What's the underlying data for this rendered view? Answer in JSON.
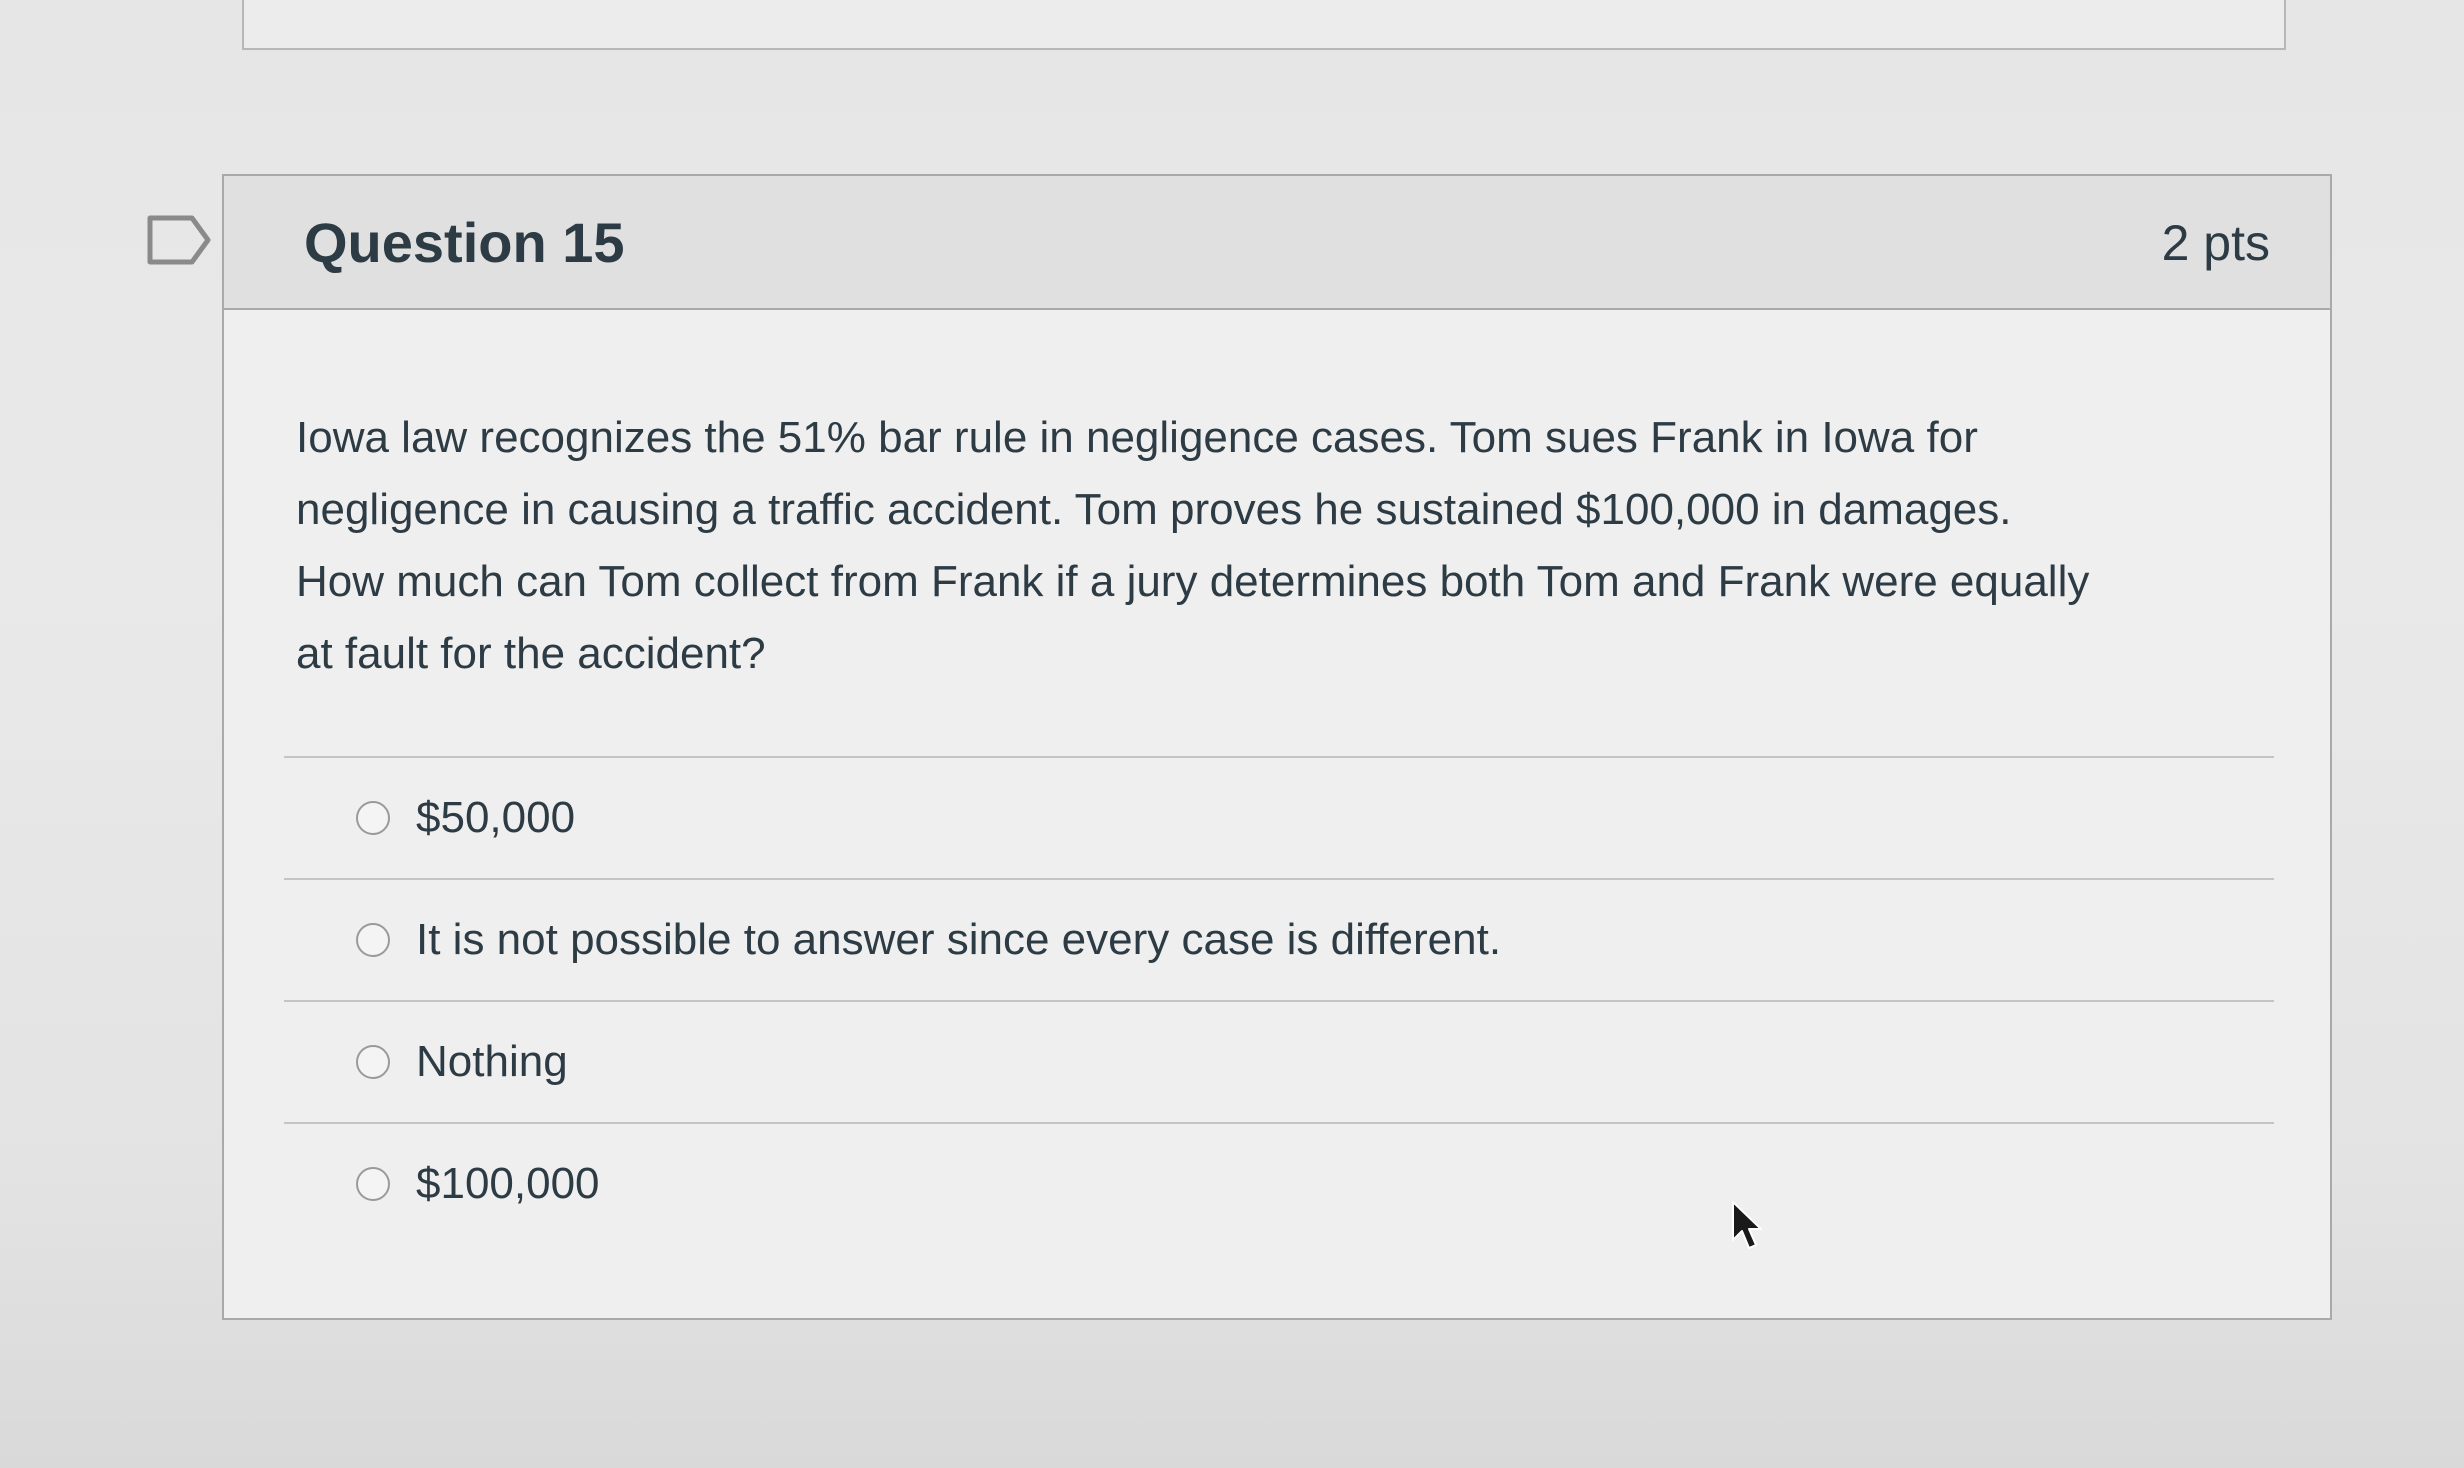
{
  "question": {
    "title": "Question 15",
    "points": "2 pts",
    "text_lines": [
      "Iowa law recognizes the 51% bar rule in negligence cases.  Tom sues Frank in Iowa for",
      "negligence in causing a traffic accident. Tom proves he sustained $100,000 in damages.",
      "How much can Tom collect from Frank if a jury determines both Tom and Frank were equally",
      "at fault for the accident?"
    ],
    "answers": [
      {
        "label": "$50,000",
        "selected": false
      },
      {
        "label": "It is not possible to answer since every case is different.",
        "selected": false
      },
      {
        "label": "Nothing",
        "selected": false
      },
      {
        "label": "$100,000",
        "selected": false
      }
    ]
  },
  "icons": {
    "flag": "flag-question-icon",
    "cursor": "mouse-pointer-icon"
  },
  "colors": {
    "text": "#2d3b45",
    "header_bg": "#e0e0e0",
    "border": "#a9a9a9"
  }
}
